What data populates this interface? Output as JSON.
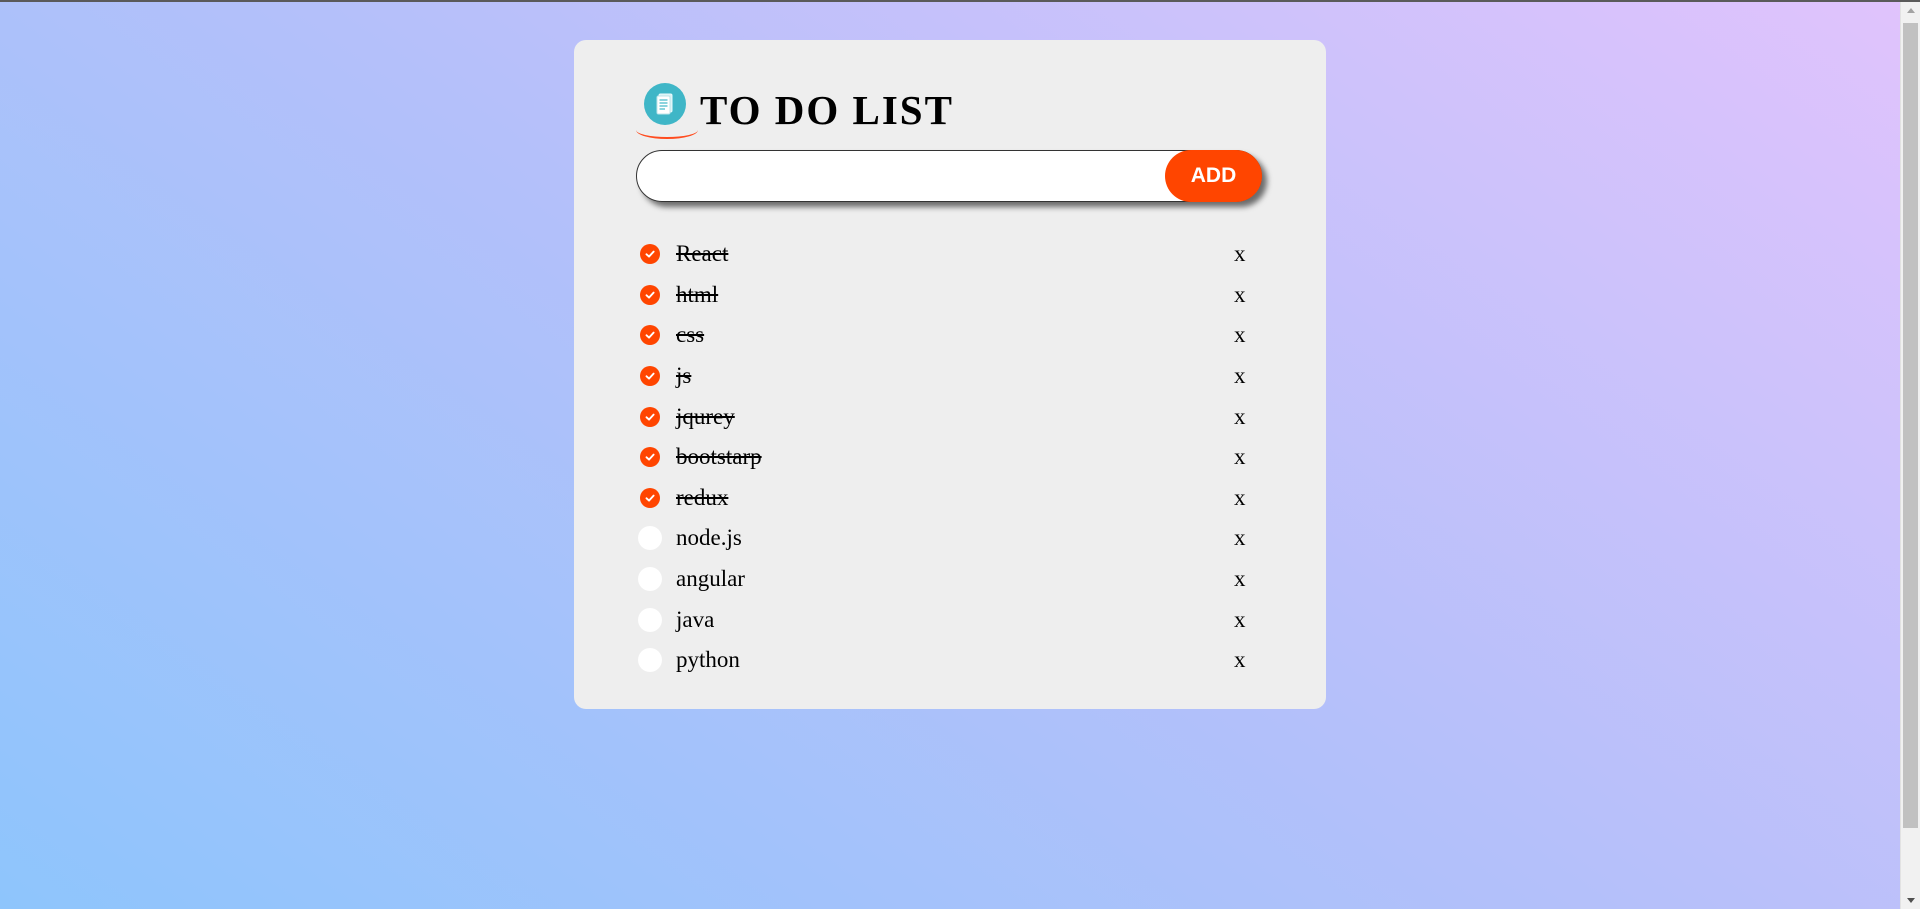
{
  "app": {
    "title": "TO DO LIST",
    "logo_icon": "notepad-icon",
    "accent_color": "#ff4500",
    "logo_color": "#3fb6c7"
  },
  "input": {
    "value": "",
    "placeholder": ""
  },
  "add_button_label": "ADD",
  "tasks": [
    {
      "text": "React",
      "done": true,
      "remove_label": "x"
    },
    {
      "text": "html",
      "done": true,
      "remove_label": "x"
    },
    {
      "text": "css",
      "done": true,
      "remove_label": "x"
    },
    {
      "text": "js",
      "done": true,
      "remove_label": "x"
    },
    {
      "text": "jqurey",
      "done": true,
      "remove_label": "x"
    },
    {
      "text": "bootstarp",
      "done": true,
      "remove_label": "x"
    },
    {
      "text": "redux",
      "done": true,
      "remove_label": "x"
    },
    {
      "text": "node.js",
      "done": false,
      "remove_label": "x"
    },
    {
      "text": "angular",
      "done": false,
      "remove_label": "x"
    },
    {
      "text": "java",
      "done": false,
      "remove_label": "x"
    },
    {
      "text": "python",
      "done": false,
      "remove_label": "x"
    }
  ]
}
